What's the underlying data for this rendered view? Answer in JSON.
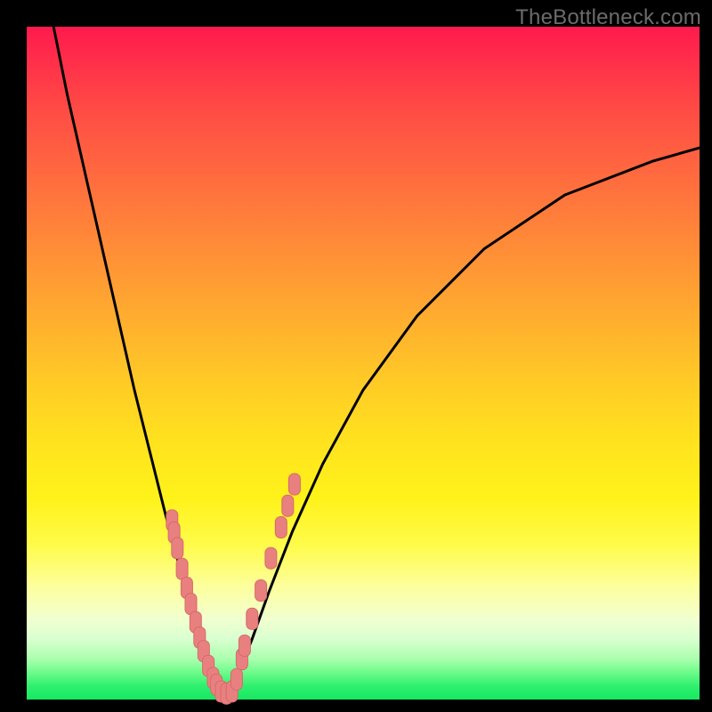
{
  "watermark": "TheBottleneck.com",
  "chart_data": {
    "type": "line",
    "title": "",
    "xlabel": "",
    "ylabel": "",
    "xlim": [
      0,
      1
    ],
    "ylim": [
      0,
      1
    ],
    "note": "Axes unlabeled; values are normalized plot coordinates (0 = left/bottom, 1 = right/top). Curve depicts a V-shaped bottleneck profile with scattered markers near the trough.",
    "series": [
      {
        "name": "curve-left",
        "x": [
          0.04,
          0.06,
          0.085,
          0.11,
          0.135,
          0.16,
          0.185,
          0.205,
          0.225,
          0.24,
          0.255,
          0.267,
          0.277,
          0.286
        ],
        "y": [
          1.0,
          0.9,
          0.79,
          0.68,
          0.57,
          0.46,
          0.36,
          0.28,
          0.205,
          0.15,
          0.1,
          0.06,
          0.03,
          0.01
        ]
      },
      {
        "name": "curve-right",
        "x": [
          0.3,
          0.315,
          0.335,
          0.36,
          0.395,
          0.44,
          0.5,
          0.58,
          0.68,
          0.8,
          0.93,
          1.0
        ],
        "y": [
          0.01,
          0.04,
          0.09,
          0.16,
          0.25,
          0.35,
          0.46,
          0.57,
          0.67,
          0.75,
          0.8,
          0.82
        ]
      },
      {
        "name": "markers",
        "x": [
          0.216,
          0.219,
          0.224,
          0.231,
          0.238,
          0.244,
          0.251,
          0.257,
          0.263,
          0.27,
          0.277,
          0.282,
          0.289,
          0.297,
          0.305,
          0.312,
          0.32,
          0.324,
          0.335,
          0.348,
          0.363,
          0.378,
          0.388,
          0.398
        ],
        "y": [
          0.266,
          0.248,
          0.225,
          0.194,
          0.166,
          0.142,
          0.115,
          0.092,
          0.072,
          0.05,
          0.032,
          0.022,
          0.012,
          0.009,
          0.012,
          0.03,
          0.06,
          0.08,
          0.12,
          0.162,
          0.21,
          0.256,
          0.288,
          0.32
        ]
      }
    ],
    "colors": {
      "curve": "#000000",
      "marker_fill": "#e98080",
      "marker_stroke": "#d66a6a",
      "gradient_top": "#ff1a4d",
      "gradient_bottom": "#17e862"
    }
  }
}
